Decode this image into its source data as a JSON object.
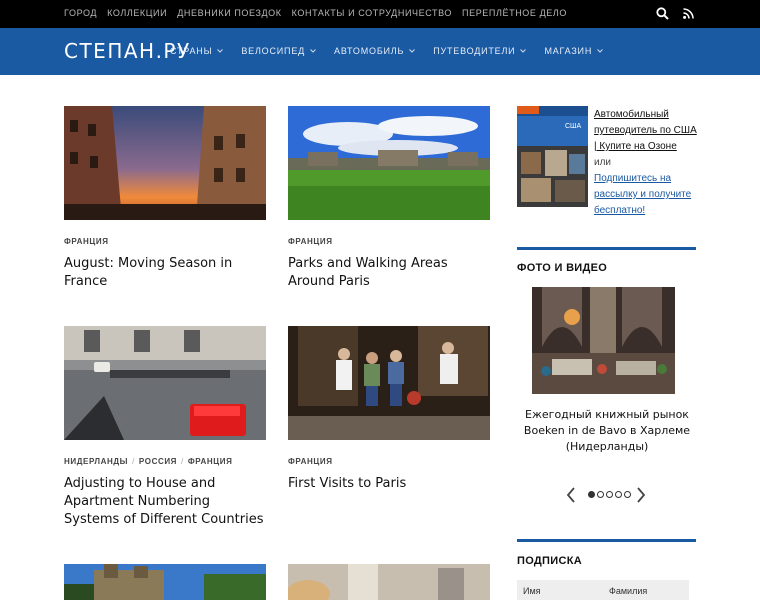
{
  "top_nav": [
    "Город",
    "Коллекции",
    "Дневники поездок",
    "Контакты и сотрудничество",
    "Переплётное дело"
  ],
  "top_icons": [
    "search-icon",
    "rss-icon"
  ],
  "header": {
    "logo": "СТЕПАН.РУ",
    "menu": [
      {
        "label": "Страны",
        "icon": "chevron-down-icon"
      },
      {
        "label": "Велосипед",
        "icon": "chevron-down-icon"
      },
      {
        "label": "Автомобиль",
        "icon": "chevron-down-icon"
      },
      {
        "label": "Путеводители",
        "icon": "chevron-down-icon"
      },
      {
        "label": "Магазин",
        "icon": "chevron-down-icon"
      }
    ]
  },
  "posts": [
    {
      "categories": [
        "Франция"
      ],
      "title": "August: Moving Season in France"
    },
    {
      "categories": [
        "Франция"
      ],
      "title": "Parks and Walking Areas Around Paris"
    },
    {
      "categories": [
        "Нидерланды",
        "Россия",
        "Франция"
      ],
      "title": "Adjusting to House and Apartment Numbering Systems of Different Countries"
    },
    {
      "categories": [
        "Франция"
      ],
      "title": "First Visits to Paris"
    },
    {
      "categories": [],
      "title": ""
    },
    {
      "categories": [],
      "title": ""
    }
  ],
  "sidebar": {
    "promo": {
      "book_badge": "США",
      "link1": "Автомобильный путеводитель по США | Купите на Озоне",
      "or": "или",
      "link2": "Подпишитесь на рассылку и получите бесплатно!"
    },
    "photo_heading": "Фото и видео",
    "photo_caption": "Ежегодный книжный рынок Boeken in de Bavo в Харлеме (Нидерланды)",
    "slider": {
      "total": 5,
      "active": 1
    },
    "subscribe_heading": "Подписка",
    "subscribe_fields": [
      "Имя",
      "Фамилия"
    ]
  },
  "colors": {
    "accent": "#1a5aa3",
    "topbar": "#000000"
  }
}
